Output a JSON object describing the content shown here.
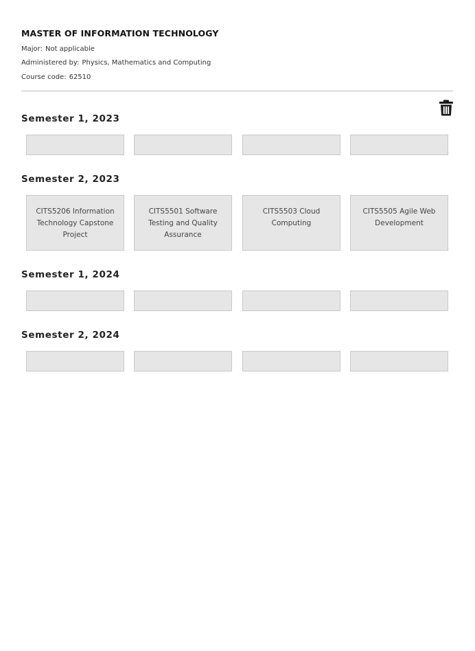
{
  "course": {
    "title": "MASTER OF INFORMATION TECHNOLOGY",
    "major_label": "Major:",
    "major_value": "Not applicable",
    "administered_label": "Administered by:",
    "administered_value": "Physics, Mathematics and Computing",
    "code_label": "Course code:",
    "code_value": "62510"
  },
  "actions": {
    "delete_icon": "trash-icon"
  },
  "semesters": [
    {
      "heading": "Semester 1, 2023",
      "units": [
        "",
        "",
        "",
        ""
      ]
    },
    {
      "heading": "Semester 2, 2023",
      "units": [
        "CITS5206 Information Technology Capstone Project",
        "CITS5501 Software Testing and Quality Assurance",
        "CITS5503 Cloud Computing",
        "CITS5505 Agile Web Development"
      ]
    },
    {
      "heading": "Semester 1, 2024",
      "units": [
        "",
        "",
        "",
        ""
      ]
    },
    {
      "heading": "Semester 2, 2024",
      "units": [
        "",
        "",
        "",
        ""
      ]
    }
  ],
  "colors": {
    "slot_background": "#e6e6e6",
    "slot_border": "#c9c9c9",
    "divider": "#bdbdbd",
    "icon": "#1a1a1a"
  }
}
